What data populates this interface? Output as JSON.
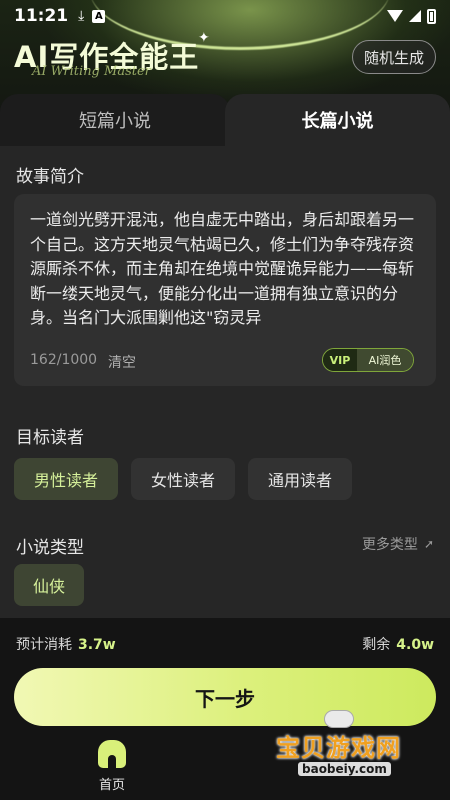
{
  "status_bar": {
    "time": "11:21",
    "icons": [
      "download-icon",
      "app-a-icon",
      "wifi-icon",
      "signal-icon",
      "battery-icon"
    ],
    "app_badge": "A"
  },
  "header": {
    "title": "AI写作全能王",
    "subtitle": "AI Writing Master",
    "random_button": "随机生成"
  },
  "tabs": [
    {
      "label": "短篇小说",
      "active": false
    },
    {
      "label": "长篇小说",
      "active": true
    }
  ],
  "story": {
    "section_label": "故事简介",
    "text": "一道剑光劈开混沌，他自虚无中踏出，身后却跟着另一个自己。这方天地灵气枯竭已久，修士们为争夺残存资源厮杀不休，而主角却在绝境中觉醒诡异能力——每斩断一缕天地灵气，便能分化出一道拥有独立意识的分身。当名门大派围剿他这\"窃灵异",
    "char_count": "162/1000",
    "clear_label": "清空",
    "vip_label": "VIP",
    "ai_polish_label": "AI润色"
  },
  "readers": {
    "section_label": "目标读者",
    "options": [
      {
        "label": "男性读者",
        "selected": true
      },
      {
        "label": "女性读者",
        "selected": false
      },
      {
        "label": "通用读者",
        "selected": false
      }
    ]
  },
  "genre": {
    "section_label": "小说类型",
    "more_label": "更多类型",
    "options": [
      {
        "label": "仙侠",
        "selected": true
      }
    ]
  },
  "cost": {
    "estimate_label": "预计消耗",
    "estimate_value": "3.7w",
    "remain_label": "剩余",
    "remain_value": "4.0w"
  },
  "next_button": "下一步",
  "bottom_nav": {
    "items": [
      {
        "label": "首页",
        "icon": "home-icon",
        "active": true
      }
    ]
  },
  "watermark": {
    "title": "宝贝游戏网",
    "url": "baobeiy.com"
  },
  "colors": {
    "accent": "#d9f07a",
    "background": "#141414",
    "panel": "#262626",
    "card": "#303030"
  }
}
